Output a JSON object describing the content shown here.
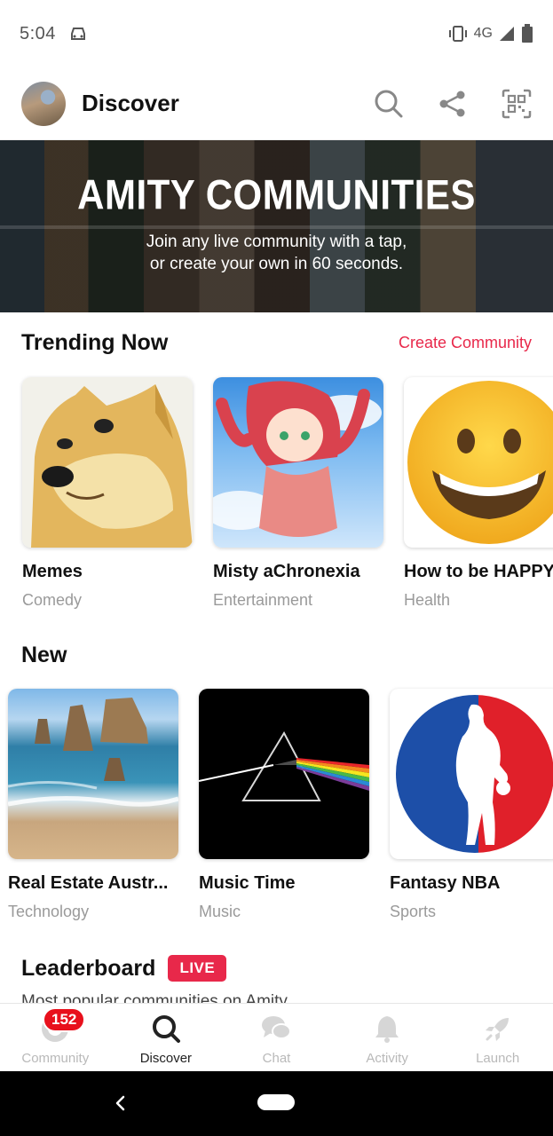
{
  "status": {
    "time": "5:04",
    "network": "4G"
  },
  "header": {
    "title": "Discover"
  },
  "banner": {
    "title": "AMITY COMMUNITIES",
    "subtitle_line1": "Join any live community with a tap,",
    "subtitle_line2": "or create your own in 60 seconds."
  },
  "trending": {
    "title": "Trending Now",
    "create_label": "Create Community",
    "cards": [
      {
        "title": "Memes",
        "category": "Comedy"
      },
      {
        "title": "Misty aChronexia",
        "category": "Entertainment"
      },
      {
        "title": "How to be HAPPY",
        "category": "Health"
      }
    ]
  },
  "new": {
    "title": "New",
    "cards": [
      {
        "title": "Real Estate Austr...",
        "category": "Technology"
      },
      {
        "title": "Music Time",
        "category": "Music"
      },
      {
        "title": "Fantasy NBA",
        "category": "Sports"
      }
    ]
  },
  "leaderboard": {
    "title": "Leaderboard",
    "badge": "LIVE",
    "subtitle": "Most popular communities on Amity"
  },
  "bottom_nav": {
    "items": [
      {
        "label": "Community",
        "badge": "152"
      },
      {
        "label": "Discover"
      },
      {
        "label": "Chat"
      },
      {
        "label": "Activity"
      },
      {
        "label": "Launch"
      }
    ]
  },
  "colors": {
    "accent": "#e8284a",
    "badge": "#e8101c"
  }
}
